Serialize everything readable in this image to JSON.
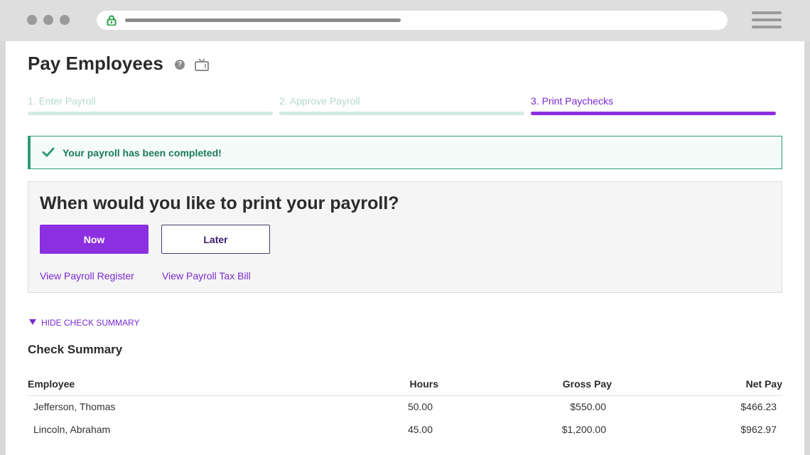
{
  "browser": {
    "icons": {
      "lock": "lock-icon",
      "menu": "hamburger-menu-icon"
    }
  },
  "page": {
    "title": "Pay Employees",
    "icons": {
      "help": "help-icon",
      "video": "video-icon"
    }
  },
  "steps": [
    {
      "label": "1. Enter Payroll",
      "state": "done"
    },
    {
      "label": "2. Approve Payroll",
      "state": "done"
    },
    {
      "label": "3. Print Paychecks",
      "state": "active"
    }
  ],
  "alert": {
    "text": "Your payroll has been completed!",
    "icon": "check-icon"
  },
  "print_panel": {
    "question": "When would you like to print your payroll?",
    "now_label": "Now",
    "later_label": "Later",
    "links": [
      "View Payroll Register",
      "View Payroll Tax Bill"
    ]
  },
  "check_summary": {
    "toggle_label": "HIDE CHECK SUMMARY",
    "title": "Check Summary",
    "columns": [
      "Employee",
      "Hours",
      "Gross Pay",
      "Net Pay"
    ],
    "rows": [
      [
        "Jefferson, Thomas",
        "50.00",
        "$550.00",
        "$466.23"
      ],
      [
        "Lincoln, Abraham",
        "45.00",
        "$1,200.00",
        "$962.97"
      ]
    ]
  },
  "colors": {
    "accent": "#8b2fe0",
    "success": "#2d9b79",
    "step_done": "#d4ebe5"
  }
}
